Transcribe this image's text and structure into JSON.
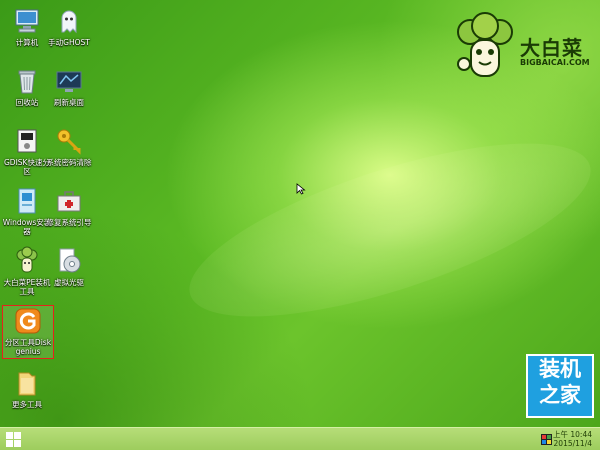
{
  "desktop_icons": [
    {
      "id": "computer",
      "label": "计算机",
      "icon": "computer-icon"
    },
    {
      "id": "ghost",
      "label": "手动GHOST",
      "icon": "ghost-icon"
    },
    {
      "id": "recycle",
      "label": "回收站",
      "icon": "recycle-bin-icon"
    },
    {
      "id": "refresh",
      "label": "刷新桌面",
      "icon": "monitor-refresh-icon"
    },
    {
      "id": "gdisk",
      "label": "GDISK快速分区",
      "icon": "gdisk-icon"
    },
    {
      "id": "password",
      "label": "系统密码清除",
      "icon": "key-icon"
    },
    {
      "id": "wininstall",
      "label": "Windows安装器",
      "icon": "windows-installer-icon"
    },
    {
      "id": "bootfix",
      "label": "修复系统引导",
      "icon": "toolbox-icon"
    },
    {
      "id": "pe",
      "label": "大白菜PE装机工具",
      "icon": "cabbage-icon"
    },
    {
      "id": "vdrive",
      "label": "虚拟光驱",
      "icon": "virtual-drive-icon"
    },
    {
      "id": "diskgenius",
      "label": "分区工具Diskgenius",
      "icon": "diskgenius-icon",
      "selected": true
    },
    {
      "id": "moretools",
      "label": "更多工具",
      "icon": "folder-icon"
    }
  ],
  "logo": {
    "cn": "大白菜",
    "en": "BIGBAICAI.COM"
  },
  "badge": {
    "line1": "装机",
    "line2": "之家"
  },
  "taskbar": {
    "time": "上午 10:44",
    "date": "2015/11/4"
  },
  "colors": {
    "accent": "#e5231b",
    "badge": "#1fa0e0",
    "taskbar": "#a9d56a"
  }
}
